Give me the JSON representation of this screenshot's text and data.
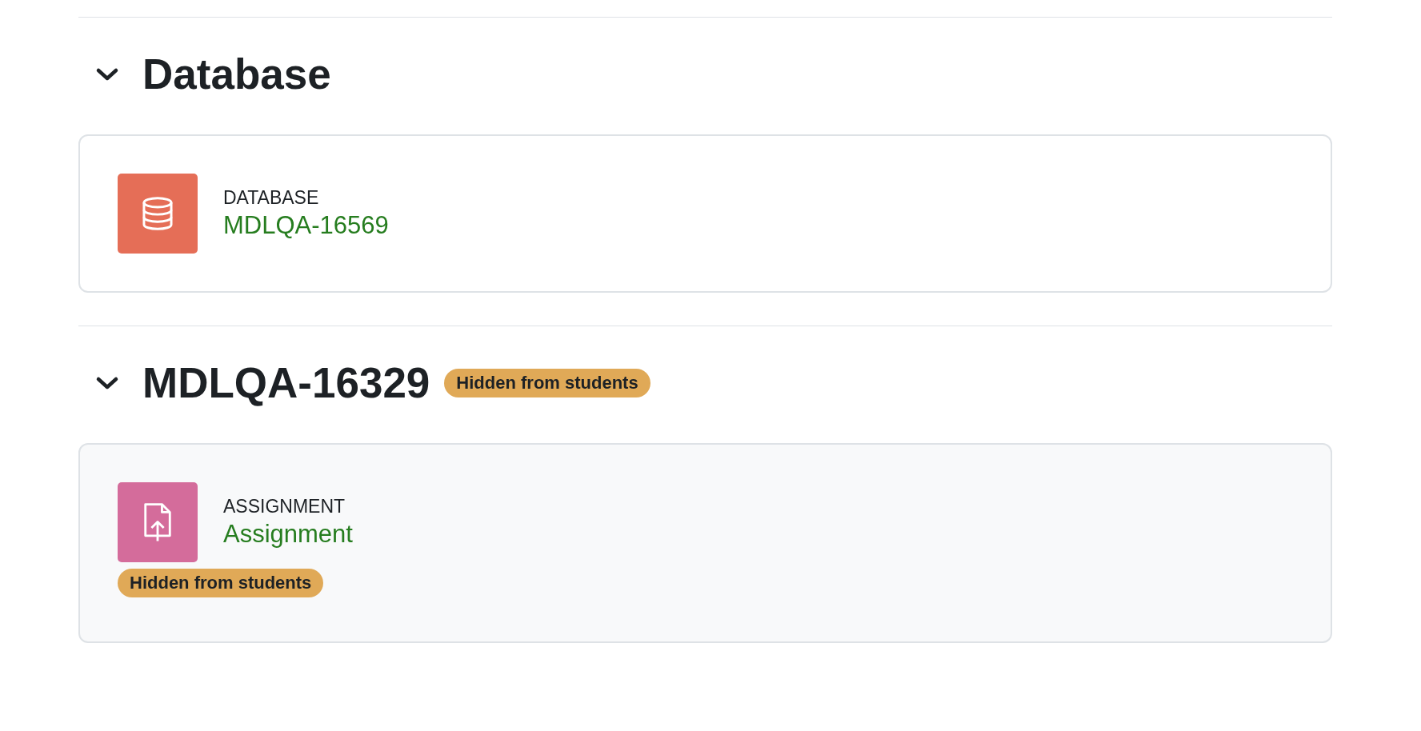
{
  "sections": [
    {
      "title": "Database",
      "expanded": true,
      "activities": [
        {
          "kind": "database",
          "type_label": "DATABASE",
          "name": "MDLQA-16569",
          "hidden": false
        }
      ]
    },
    {
      "title": "MDLQA-16329",
      "expanded": true,
      "badge": "Hidden from students",
      "activities": [
        {
          "kind": "assignment",
          "type_label": "ASSIGNMENT",
          "name": "Assignment",
          "hidden": true,
          "badge": "Hidden from students"
        }
      ]
    }
  ]
}
